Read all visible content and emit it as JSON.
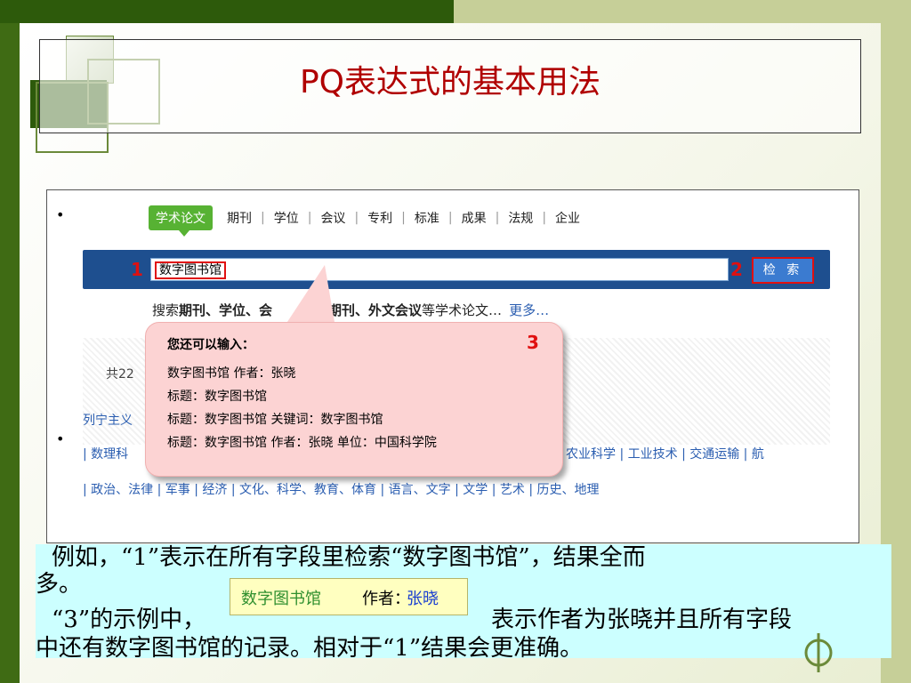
{
  "slide": {
    "title": "PQ表达式的基本用法",
    "colors": {
      "title": "#b00000",
      "accent_green": "#57b233",
      "search_bar": "#1e4f8f",
      "callout": "#fcd3d3",
      "highlight_box": "#ccffff"
    }
  },
  "screenshot": {
    "tabs": {
      "active": "学术论文",
      "items": [
        "期刊",
        "学位",
        "会议",
        "专利",
        "标准",
        "成果",
        "法规",
        "企业"
      ]
    },
    "search": {
      "label_1": "1",
      "value": "数字图书馆",
      "label_2": "2",
      "button": "检 索"
    },
    "hint": {
      "prefix": "搜索",
      "b1": "期刊、学位、会",
      "mid": "文期刊、外文会议",
      "suffix": "等学术论文…",
      "more": "更多…"
    },
    "count_text": "共22",
    "cat_line": "列宁主义",
    "cat_row1_left": "| 数理科",
    "cat_row1_right": "农业科学 | 工业技术 | 交通运输 | 航",
    "cat_row2": "| 政治、法律 | 军事 | 经济 | 文化、科学、教育、体育 | 语言、文字 | 文学 | 艺术 | 历史、地理",
    "callout": {
      "header": "您还可以输入：",
      "number": "3",
      "lines": [
        "数字图书馆  作者：张晓",
        "标题：数字图书馆",
        "标题：数字图书馆 关键词：数字图书馆",
        "标题：数字图书馆  作者：张晓  单位：中国科学院"
      ]
    }
  },
  "explanation": {
    "line1": "例如，“1”表示在所有字段里检索“数字图书馆”，结果全而",
    "line2": "多。",
    "line3_left": "“3”的示例中，",
    "line3_right": "表示作者为张晓并且所有字段",
    "line4": "中还有数字图书馆的记录。相对于“1”结果会更准确。",
    "inline_example": {
      "part1": "数字图书馆",
      "part2": "作者：",
      "part3": "张晓"
    }
  }
}
